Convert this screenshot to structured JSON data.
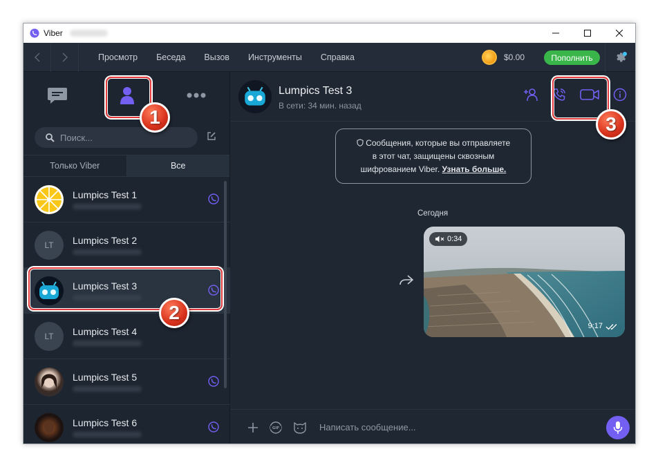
{
  "window": {
    "title": "Viber",
    "controls": [
      "minimize",
      "maximize",
      "close"
    ]
  },
  "menu": {
    "items": [
      "Просмотр",
      "Беседа",
      "Вызов",
      "Инструменты",
      "Справка"
    ],
    "balance": "$0.00",
    "topup_label": "Пополнить"
  },
  "sidebar": {
    "tabs": [
      "chats-icon",
      "contacts-icon",
      "more-icon"
    ],
    "search_placeholder": "Поиск...",
    "filters": [
      "Только Viber",
      "Все"
    ],
    "active_filter": "Все",
    "contacts": [
      {
        "name": "Lumpics Test 1",
        "avatar": "lemon",
        "viber": true
      },
      {
        "name": "Lumpics Test 2",
        "avatar": "LT",
        "viber": false
      },
      {
        "name": "Lumpics Test 3",
        "avatar": "robot",
        "viber": true,
        "selected": true
      },
      {
        "name": "Lumpics Test 4",
        "avatar": "LT",
        "viber": false
      },
      {
        "name": "Lumpics Test 5",
        "avatar": "photo",
        "viber": true
      },
      {
        "name": "Lumpics Test 6",
        "avatar": "photo-dark",
        "viber": true
      }
    ]
  },
  "chat": {
    "name": "Lumpics Test 3",
    "status": "В сети: 34 мин. назад",
    "notice_lines": [
      "Сообщения, которые вы отправляете",
      "в этот чат, защищены сквозным",
      "шифрованием Viber."
    ],
    "notice_link": "Узнать больше.",
    "date_label": "Сегодня",
    "video": {
      "duration": "0:34",
      "time": "9:17"
    },
    "composer_placeholder": "Написать сообщение..."
  },
  "markers": [
    "1",
    "2",
    "3"
  ],
  "colors": {
    "accent": "#7360f2",
    "topup": "#39b54a",
    "highlight": "#e23a3a"
  }
}
